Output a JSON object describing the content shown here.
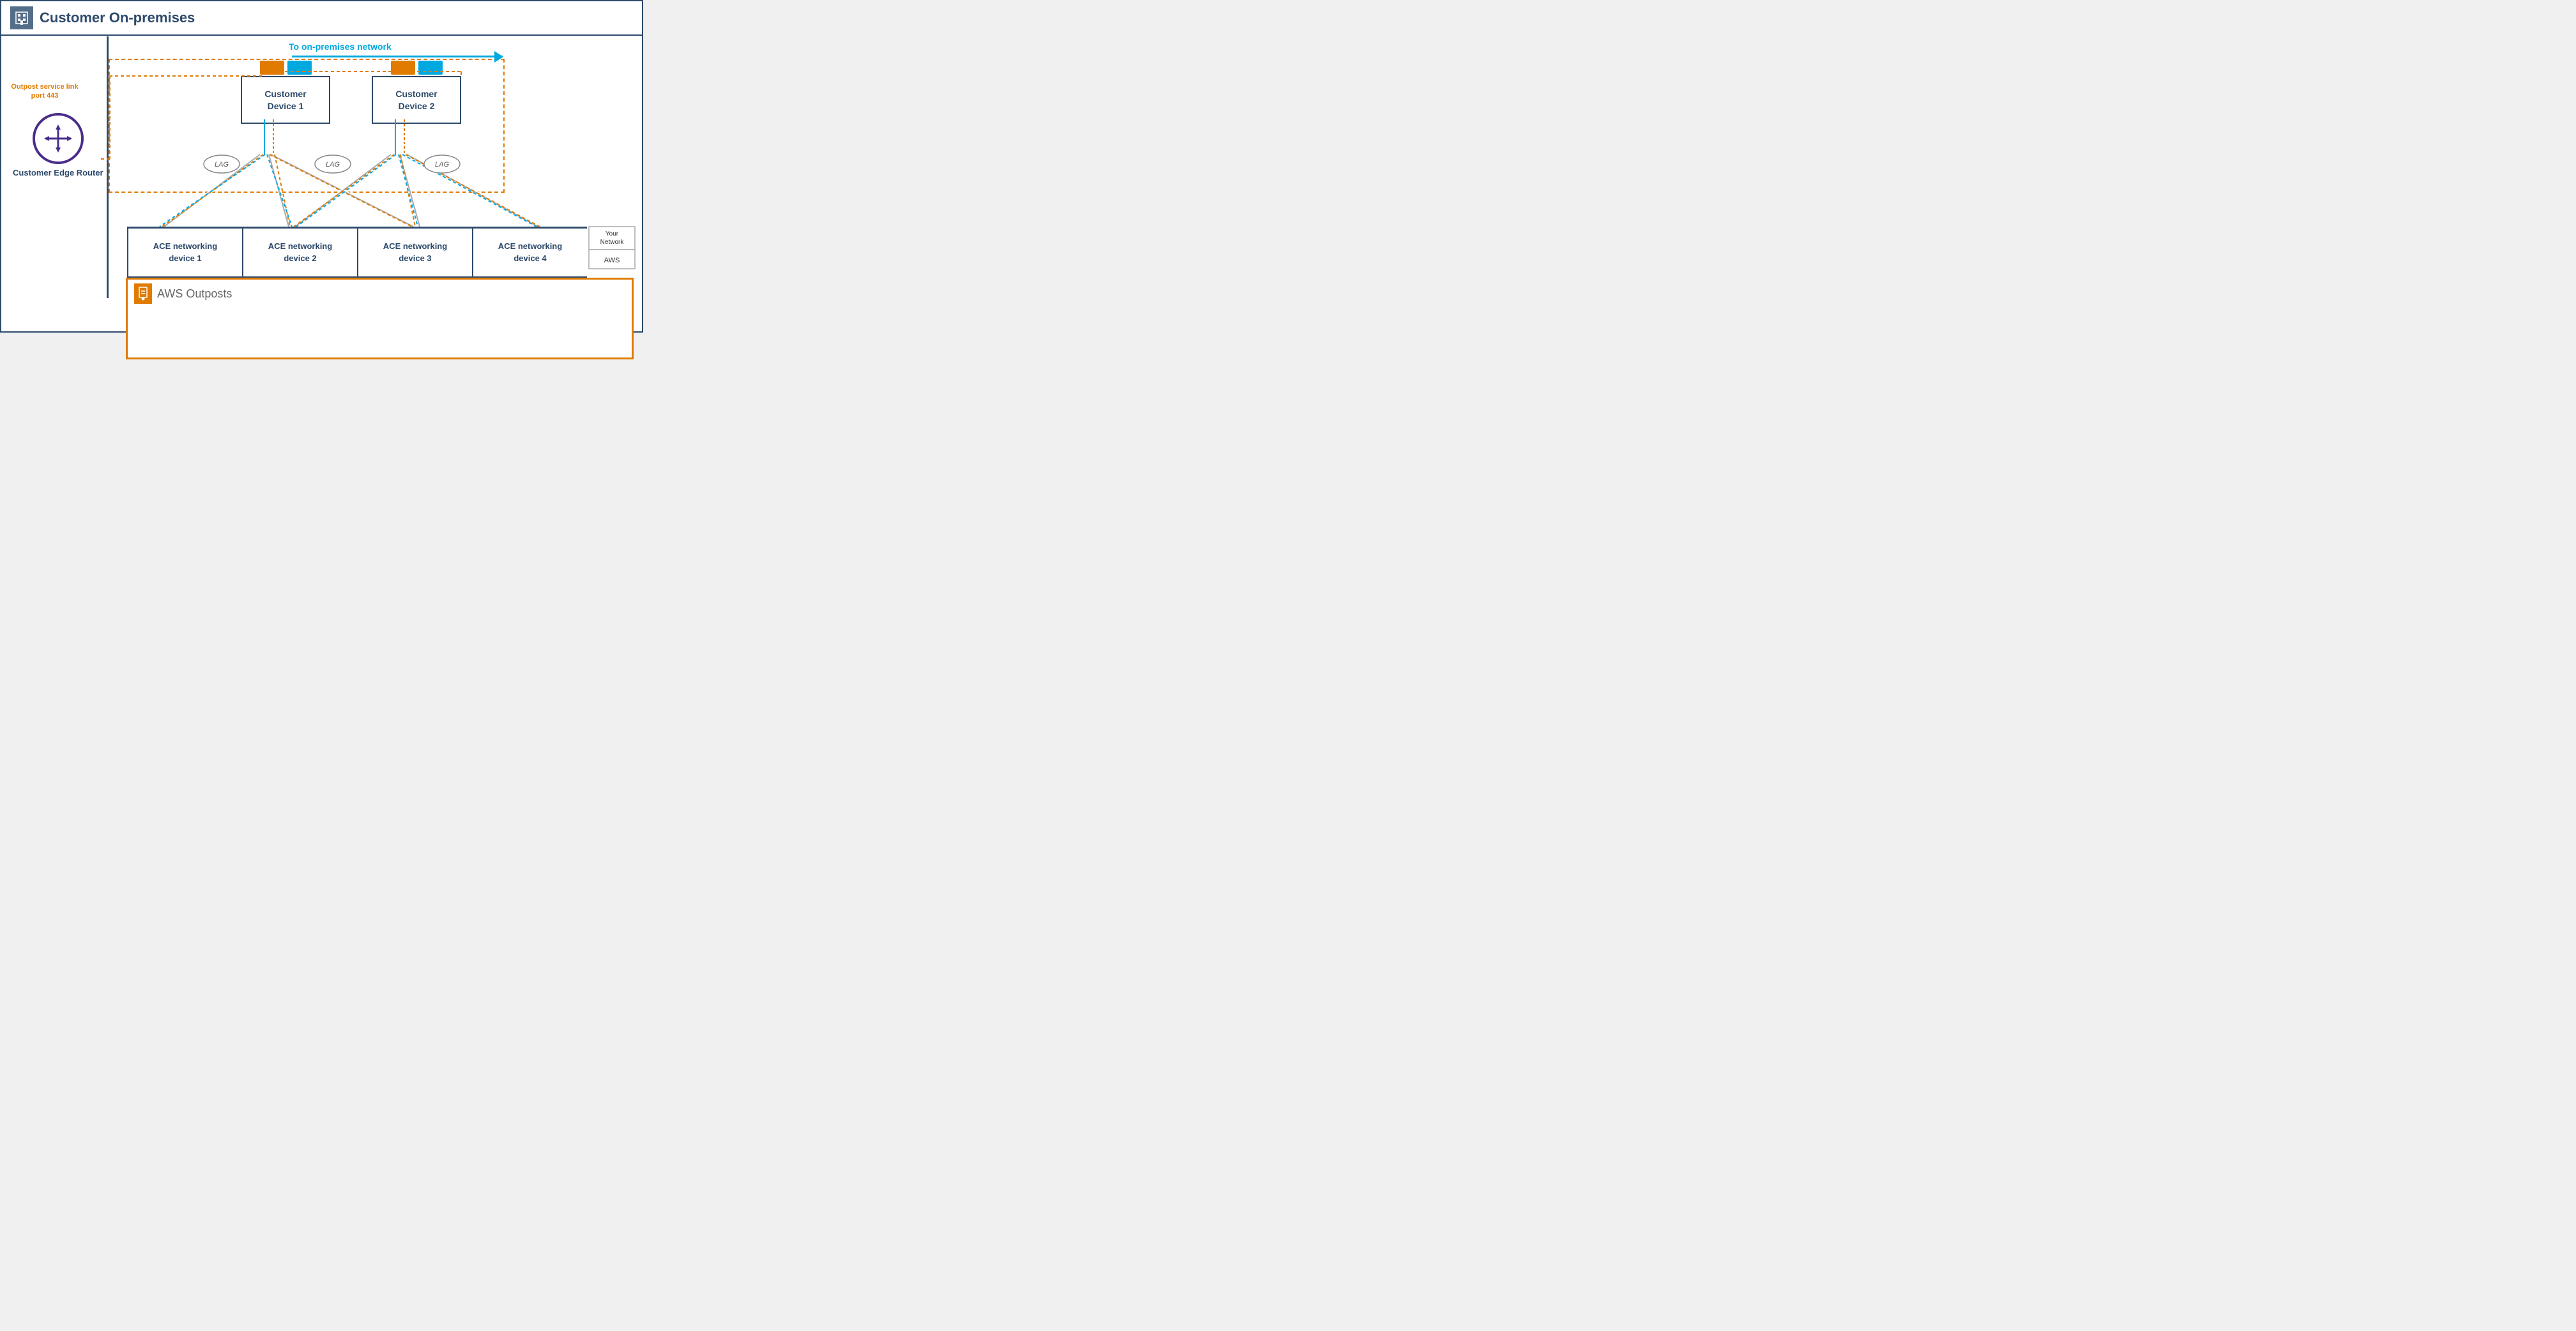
{
  "header": {
    "title": "Customer On-premises",
    "icon": "🏢"
  },
  "arrow": {
    "label": "To on-premises network"
  },
  "service_link": {
    "label": "Outpost service link\nport 443"
  },
  "customer_devices": [
    {
      "label": "Customer\nDevice 1"
    },
    {
      "label": "Customer\nDevice 2"
    }
  ],
  "lag_labels": [
    "LAG",
    "LAG",
    "LAG"
  ],
  "ace_devices": [
    {
      "label": "ACE networking\ndevice 1"
    },
    {
      "label": "ACE networking\ndevice 2"
    },
    {
      "label": "ACE networking\ndevice 3"
    },
    {
      "label": "ACE networking\ndevice 4"
    }
  ],
  "right_labels": {
    "your_network": "Your\nNetwork",
    "aws": "AWS"
  },
  "outposts": {
    "title": "AWS Outposts",
    "icon": "📦"
  },
  "router": {
    "label": "Customer\nEdge Router"
  }
}
